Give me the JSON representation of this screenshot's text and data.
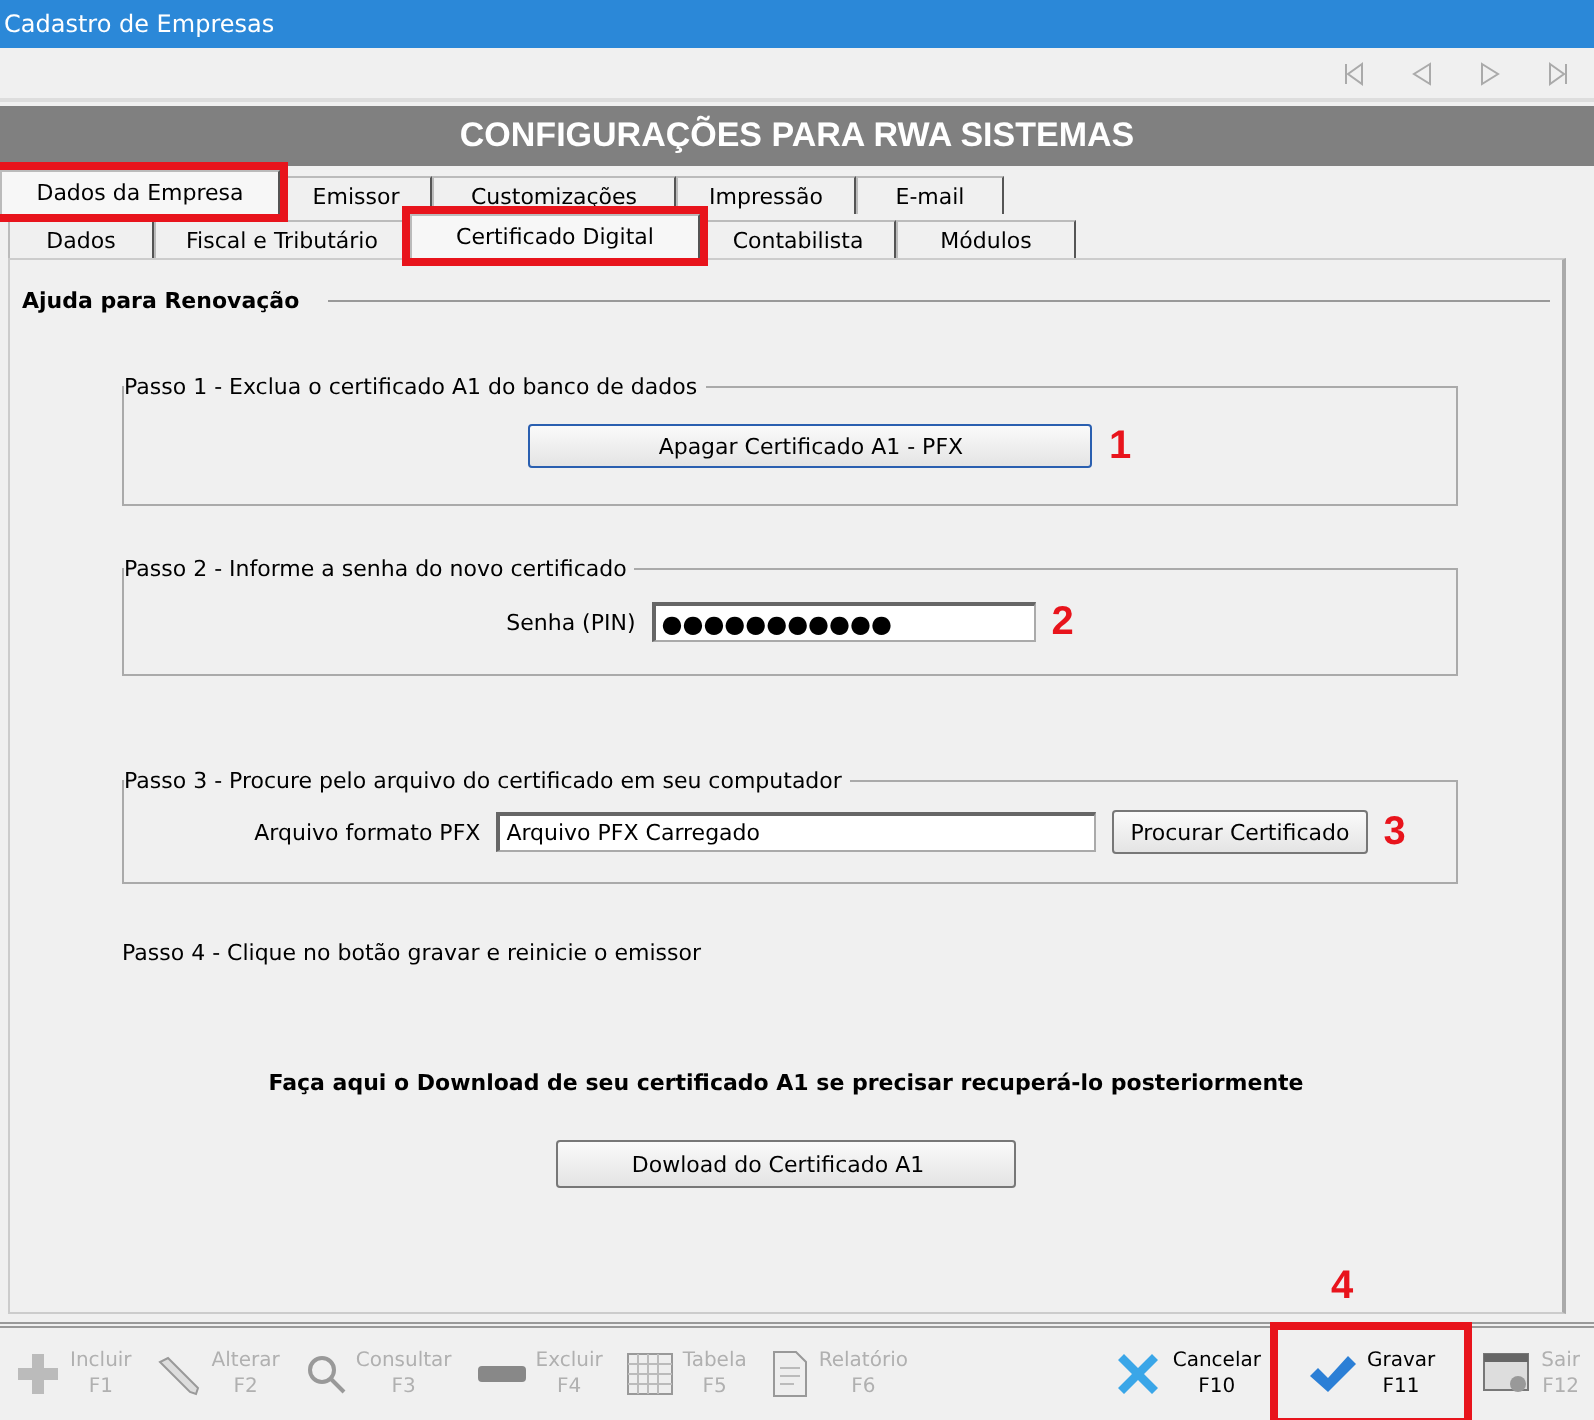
{
  "window": {
    "title": "Cadastro de Empresas"
  },
  "header": "CONFIGURAÇÕES PARA RWA SISTEMAS",
  "tabs": [
    {
      "label": "Dados da Empresa",
      "selected": true,
      "highlighted": true
    },
    {
      "label": "Emissor",
      "selected": false,
      "highlighted": false
    },
    {
      "label": "Customizações",
      "selected": false,
      "highlighted": false
    },
    {
      "label": "Impressão",
      "selected": false,
      "highlighted": false
    },
    {
      "label": "E-mail",
      "selected": false,
      "highlighted": false
    }
  ],
  "subtabs": [
    {
      "label": "Dados",
      "selected": false,
      "highlighted": false
    },
    {
      "label": "Fiscal e Tributário",
      "selected": false,
      "highlighted": false
    },
    {
      "label": "Certificado Digital",
      "selected": true,
      "highlighted": true
    },
    {
      "label": "Contabilista",
      "selected": false,
      "highlighted": false
    },
    {
      "label": "Módulos",
      "selected": false,
      "highlighted": false
    }
  ],
  "section_title": "Ajuda para Renovação",
  "step1": {
    "legend": "Passo 1 - Exclua o certificado A1 do banco de dados",
    "button": "Apagar Certificado A1 - PFX",
    "marker": "1"
  },
  "step2": {
    "legend": "Passo 2 - Informe a senha do novo certificado",
    "label": "Senha (PIN)",
    "value": "●●●●●●●●●●●",
    "marker": "2"
  },
  "step3": {
    "legend": "Passo 3 - Procure pelo arquivo do certificado em seu computador",
    "label": "Arquivo formato PFX",
    "value": "Arquivo PFX Carregado",
    "button": "Procurar Certificado",
    "marker": "3"
  },
  "step4": "Passo 4 - Clique no botão gravar e reinicie o emissor",
  "download_note": "Faça aqui o Download de seu certificado A1 se precisar recuperá-lo posteriormente",
  "download_button": "Dowload do Certificado A1",
  "toolbar": [
    {
      "kind": "plus",
      "label": "Incluir",
      "key": "F1",
      "disabled": true,
      "highlighted": false
    },
    {
      "kind": "pencil",
      "label": "Alterar",
      "key": "F2",
      "disabled": true,
      "highlighted": false
    },
    {
      "kind": "search",
      "label": "Consultar",
      "key": "F3",
      "disabled": true,
      "highlighted": false
    },
    {
      "kind": "minus",
      "label": "Excluir",
      "key": "F4",
      "disabled": true,
      "highlighted": false
    },
    {
      "kind": "table",
      "label": "Tabela",
      "key": "F5",
      "disabled": true,
      "highlighted": false
    },
    {
      "kind": "document",
      "label": "Relatório",
      "key": "F6",
      "disabled": true,
      "highlighted": false
    },
    {
      "kind": "cancel",
      "label": "Cancelar",
      "key": "F10",
      "disabled": false,
      "highlighted": false
    },
    {
      "kind": "check",
      "label": "Gravar",
      "key": "F11",
      "disabled": false,
      "highlighted": true,
      "marker": "4"
    },
    {
      "kind": "exit",
      "label": "Sair",
      "key": "F12",
      "disabled": true,
      "highlighted": false
    }
  ]
}
